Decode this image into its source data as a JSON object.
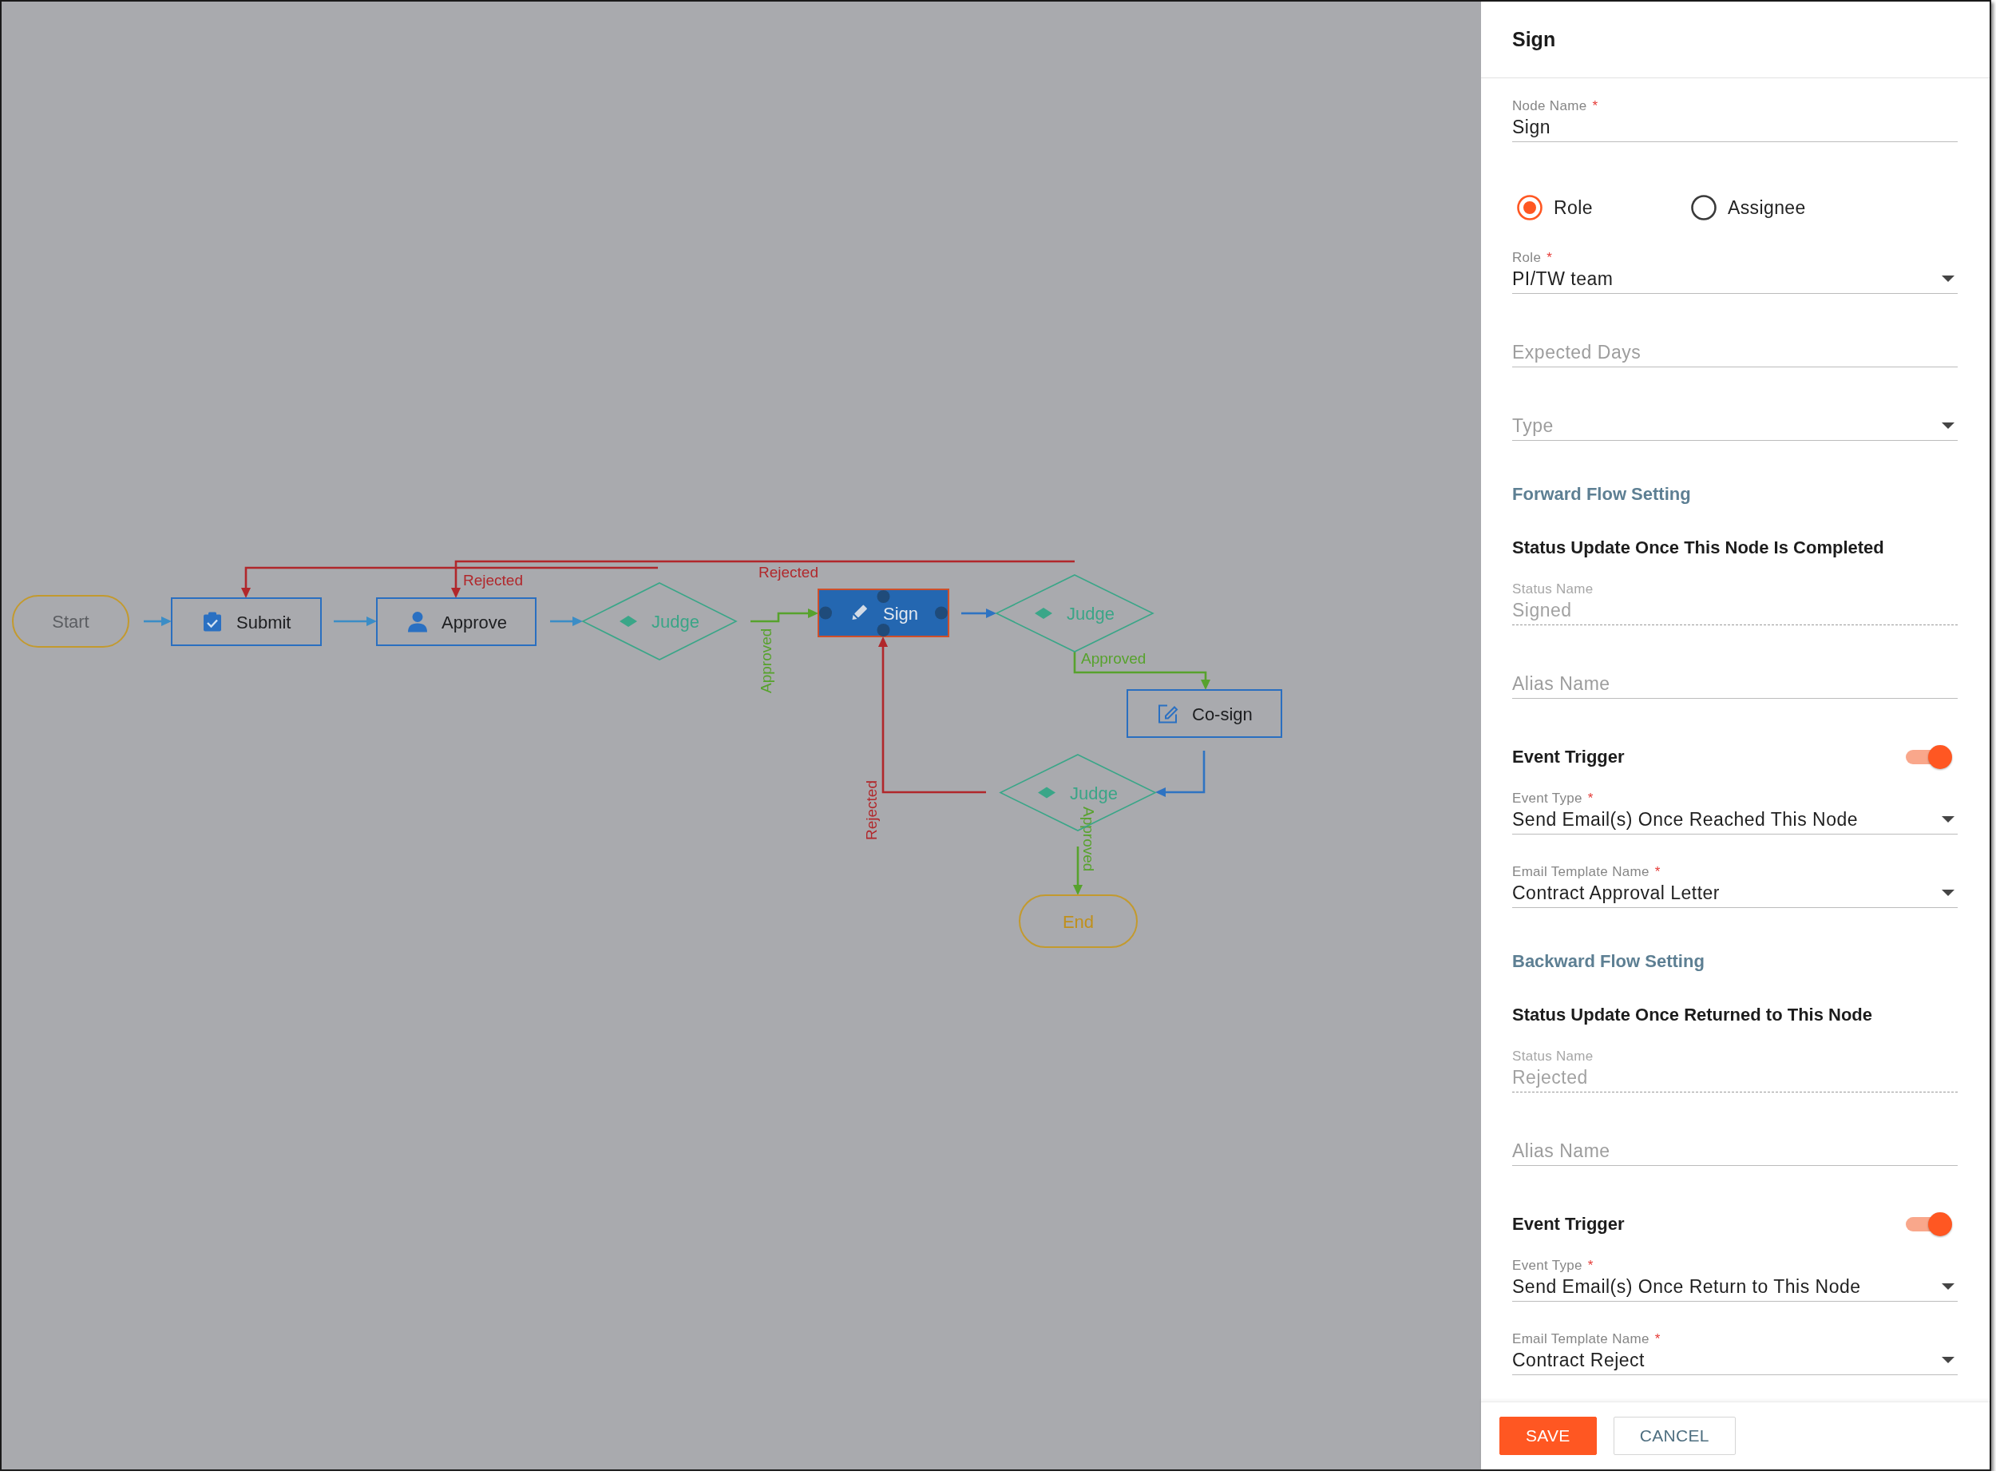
{
  "diagram": {
    "nodes": [
      {
        "kind": "start",
        "label": "Start",
        "selected": false
      },
      {
        "kind": "task",
        "label": "Submit",
        "selected": false
      },
      {
        "kind": "task",
        "label": "Approve",
        "selected": false
      },
      {
        "kind": "decision",
        "label": "Judge",
        "selected": false
      },
      {
        "kind": "task",
        "label": "Sign",
        "selected": true
      },
      {
        "kind": "decision",
        "label": "Judge",
        "selected": false
      },
      {
        "kind": "task",
        "label": "Co-sign",
        "selected": false
      },
      {
        "kind": "decision",
        "label": "Judge",
        "selected": false
      },
      {
        "kind": "end",
        "label": "End",
        "selected": false
      }
    ],
    "edges": [
      {
        "color": "#3b8dc6"
      },
      {
        "color": "#3b8dc6"
      },
      {
        "color": "#3b8dc6"
      },
      {
        "color": "#57a22d",
        "label": "Approved"
      },
      {
        "color": "#2e73c2"
      },
      {
        "color": "#57a22d",
        "label": "Approved"
      },
      {
        "color": "#2e73c2"
      },
      {
        "color": "#b1272b",
        "label": "Rejected"
      },
      {
        "color": "#57a22d",
        "label": "Approved"
      },
      {
        "color": "#b1272b",
        "label": "Rejected"
      },
      {
        "color": "#b1272b",
        "label": "Rejected"
      }
    ]
  },
  "panel": {
    "title": "Sign",
    "items": [
      {
        "kind": "text-field",
        "label": "Node Name",
        "required_mark": "*",
        "value": "Sign",
        "disabled": false
      },
      {
        "kind": "radio-group",
        "options": [
          {
            "label": "Role",
            "selected": true
          },
          {
            "label": "Assignee",
            "selected": false
          }
        ]
      },
      {
        "kind": "select",
        "label": "Role",
        "required_mark": "*",
        "value": "PI/TW team"
      },
      {
        "kind": "text-field",
        "placeholder": "Expected Days",
        "disabled": false
      },
      {
        "kind": "select",
        "placeholder": "Type"
      },
      {
        "kind": "section-title",
        "text": "Forward Flow Setting"
      },
      {
        "kind": "subtitle",
        "text": "Status Update Once This Node Is Completed"
      },
      {
        "kind": "text-field",
        "label": "Status Name",
        "value": "Signed",
        "disabled": true
      },
      {
        "kind": "text-field",
        "placeholder": "Alias Name",
        "disabled": false
      },
      {
        "kind": "toggle",
        "label": "Event Trigger",
        "on": true
      },
      {
        "kind": "select",
        "label": "Event Type",
        "required_mark": "*",
        "value": "Send Email(s) Once Reached This Node"
      },
      {
        "kind": "select",
        "label": "Email Template Name",
        "required_mark": "*",
        "value": "Contract Approval Letter"
      },
      {
        "kind": "section-title",
        "text": "Backward Flow Setting"
      },
      {
        "kind": "subtitle",
        "text": "Status Update Once Returned to This Node"
      },
      {
        "kind": "text-field",
        "label": "Status Name",
        "value": "Rejected",
        "disabled": true
      },
      {
        "kind": "text-field",
        "placeholder": "Alias Name",
        "disabled": false
      },
      {
        "kind": "toggle",
        "label": "Event Trigger",
        "on": true
      },
      {
        "kind": "select",
        "label": "Event Type",
        "required_mark": "*",
        "value": "Send Email(s) Once Return to This Node"
      },
      {
        "kind": "select",
        "label": "Email Template Name",
        "required_mark": "*",
        "value": "Contract Reject"
      }
    ],
    "buttons": [
      {
        "kind": "primary",
        "label": "SAVE"
      },
      {
        "kind": "secondary",
        "label": "CANCEL"
      }
    ]
  }
}
